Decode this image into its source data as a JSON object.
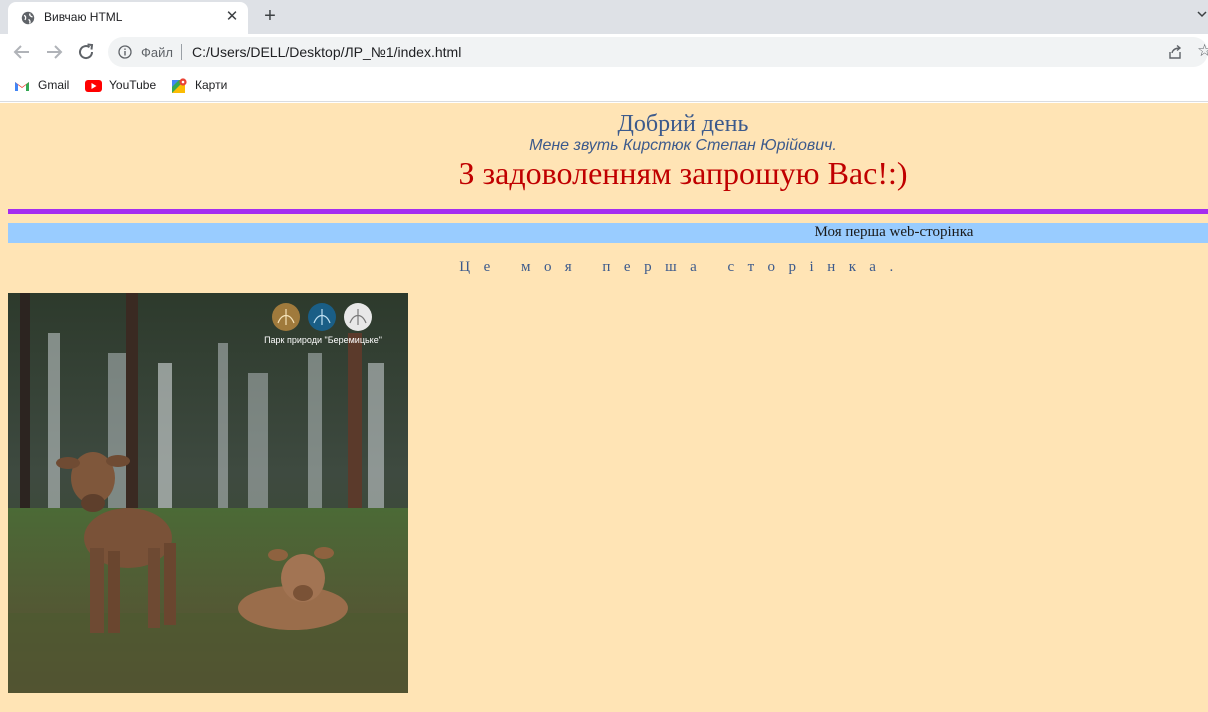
{
  "browser": {
    "tab": {
      "title": "Вивчаю HTML",
      "favicon": "globe-icon"
    },
    "omnibox": {
      "scheme_label": "Файл",
      "url": "C:/Users/DELL/Desktop/ЛР_№1/index.html"
    },
    "bookmarks": [
      {
        "label": "Gmail",
        "icon": "gmail-icon"
      },
      {
        "label": "YouTube",
        "icon": "youtube-icon"
      },
      {
        "label": "Карти",
        "icon": "maps-icon"
      }
    ]
  },
  "page": {
    "background": "#ffe4b5",
    "greeting": "Добрий день",
    "intro": "Мене звуть Кирстюк Степан Юрійович.",
    "invite": "З задоволенням запрошую Вас!:)",
    "banner": "Моя перша web-сторінка",
    "spaced_line": "Це моя перша сторінка.",
    "photo": {
      "watermark": "Парк природи \"Беремицьке\"",
      "logo_colors": [
        "#a07a3c",
        "#1a5e86",
        "#e8e8e8"
      ]
    }
  },
  "colors": {
    "heading_blue": "#3c5a8c",
    "invite_red": "#c00000",
    "rule_purple": "#a52cf0",
    "banner_blue": "#99ccff"
  }
}
